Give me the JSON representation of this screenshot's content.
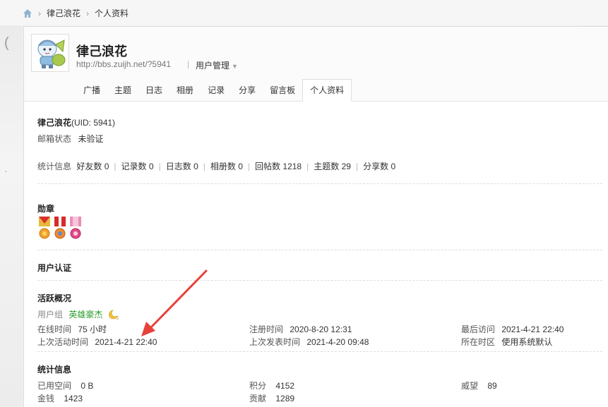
{
  "breadcrumb": {
    "items": [
      "律己浪花",
      "个人资料"
    ]
  },
  "profile": {
    "name": "律己浪花",
    "url": "http://bbs.zuijh.net/?5941",
    "user_mgmt": "用户管理",
    "tabs": [
      "广播",
      "主题",
      "日志",
      "相册",
      "记录",
      "分享",
      "留言板",
      "个人资料"
    ],
    "active_tab": "个人资料"
  },
  "info": {
    "name_uid": "律己浪花",
    "uid_suffix": "(UID: 5941)",
    "email_label": "邮箱状态",
    "email_value": "未验证",
    "stats_label": "统计信息",
    "stats": [
      {
        "label": "好友数",
        "value": "0"
      },
      {
        "label": "记录数",
        "value": "0"
      },
      {
        "label": "日志数",
        "value": "0"
      },
      {
        "label": "相册数",
        "value": "0"
      },
      {
        "label": "回帖数",
        "value": "1218"
      },
      {
        "label": "主题数",
        "value": "29"
      },
      {
        "label": "分享数",
        "value": "0"
      }
    ]
  },
  "medals": {
    "title": "勋章"
  },
  "certification": {
    "title": "用户认证"
  },
  "activity": {
    "title": "活跃概况",
    "group_label": "用户组",
    "group_value": "英雄豪杰",
    "online_label": "在线时间",
    "online_value": "75 小时",
    "register_label": "注册时间",
    "register_value": "2020-8-20 12:31",
    "last_visit_label": "最后访问",
    "last_visit_value": "2021-4-21 22:40",
    "last_active_label": "上次活动时间",
    "last_active_value": "2021-4-21 22:40",
    "last_post_label": "上次发表时间",
    "last_post_value": "2021-4-20 09:48",
    "timezone_label": "所在时区",
    "timezone_value": "使用系统默认"
  },
  "statistics": {
    "title": "统计信息",
    "space_label": "已用空间",
    "space_value": "0 B",
    "points_label": "积分",
    "points_value": "4152",
    "prestige_label": "威望",
    "prestige_value": "89",
    "money_label": "金钱",
    "money_value": "1423",
    "contrib_label": "贡献",
    "contrib_value": "1289"
  },
  "colors": {
    "arrow": "#e8413b",
    "group": "#2a9d2a"
  }
}
